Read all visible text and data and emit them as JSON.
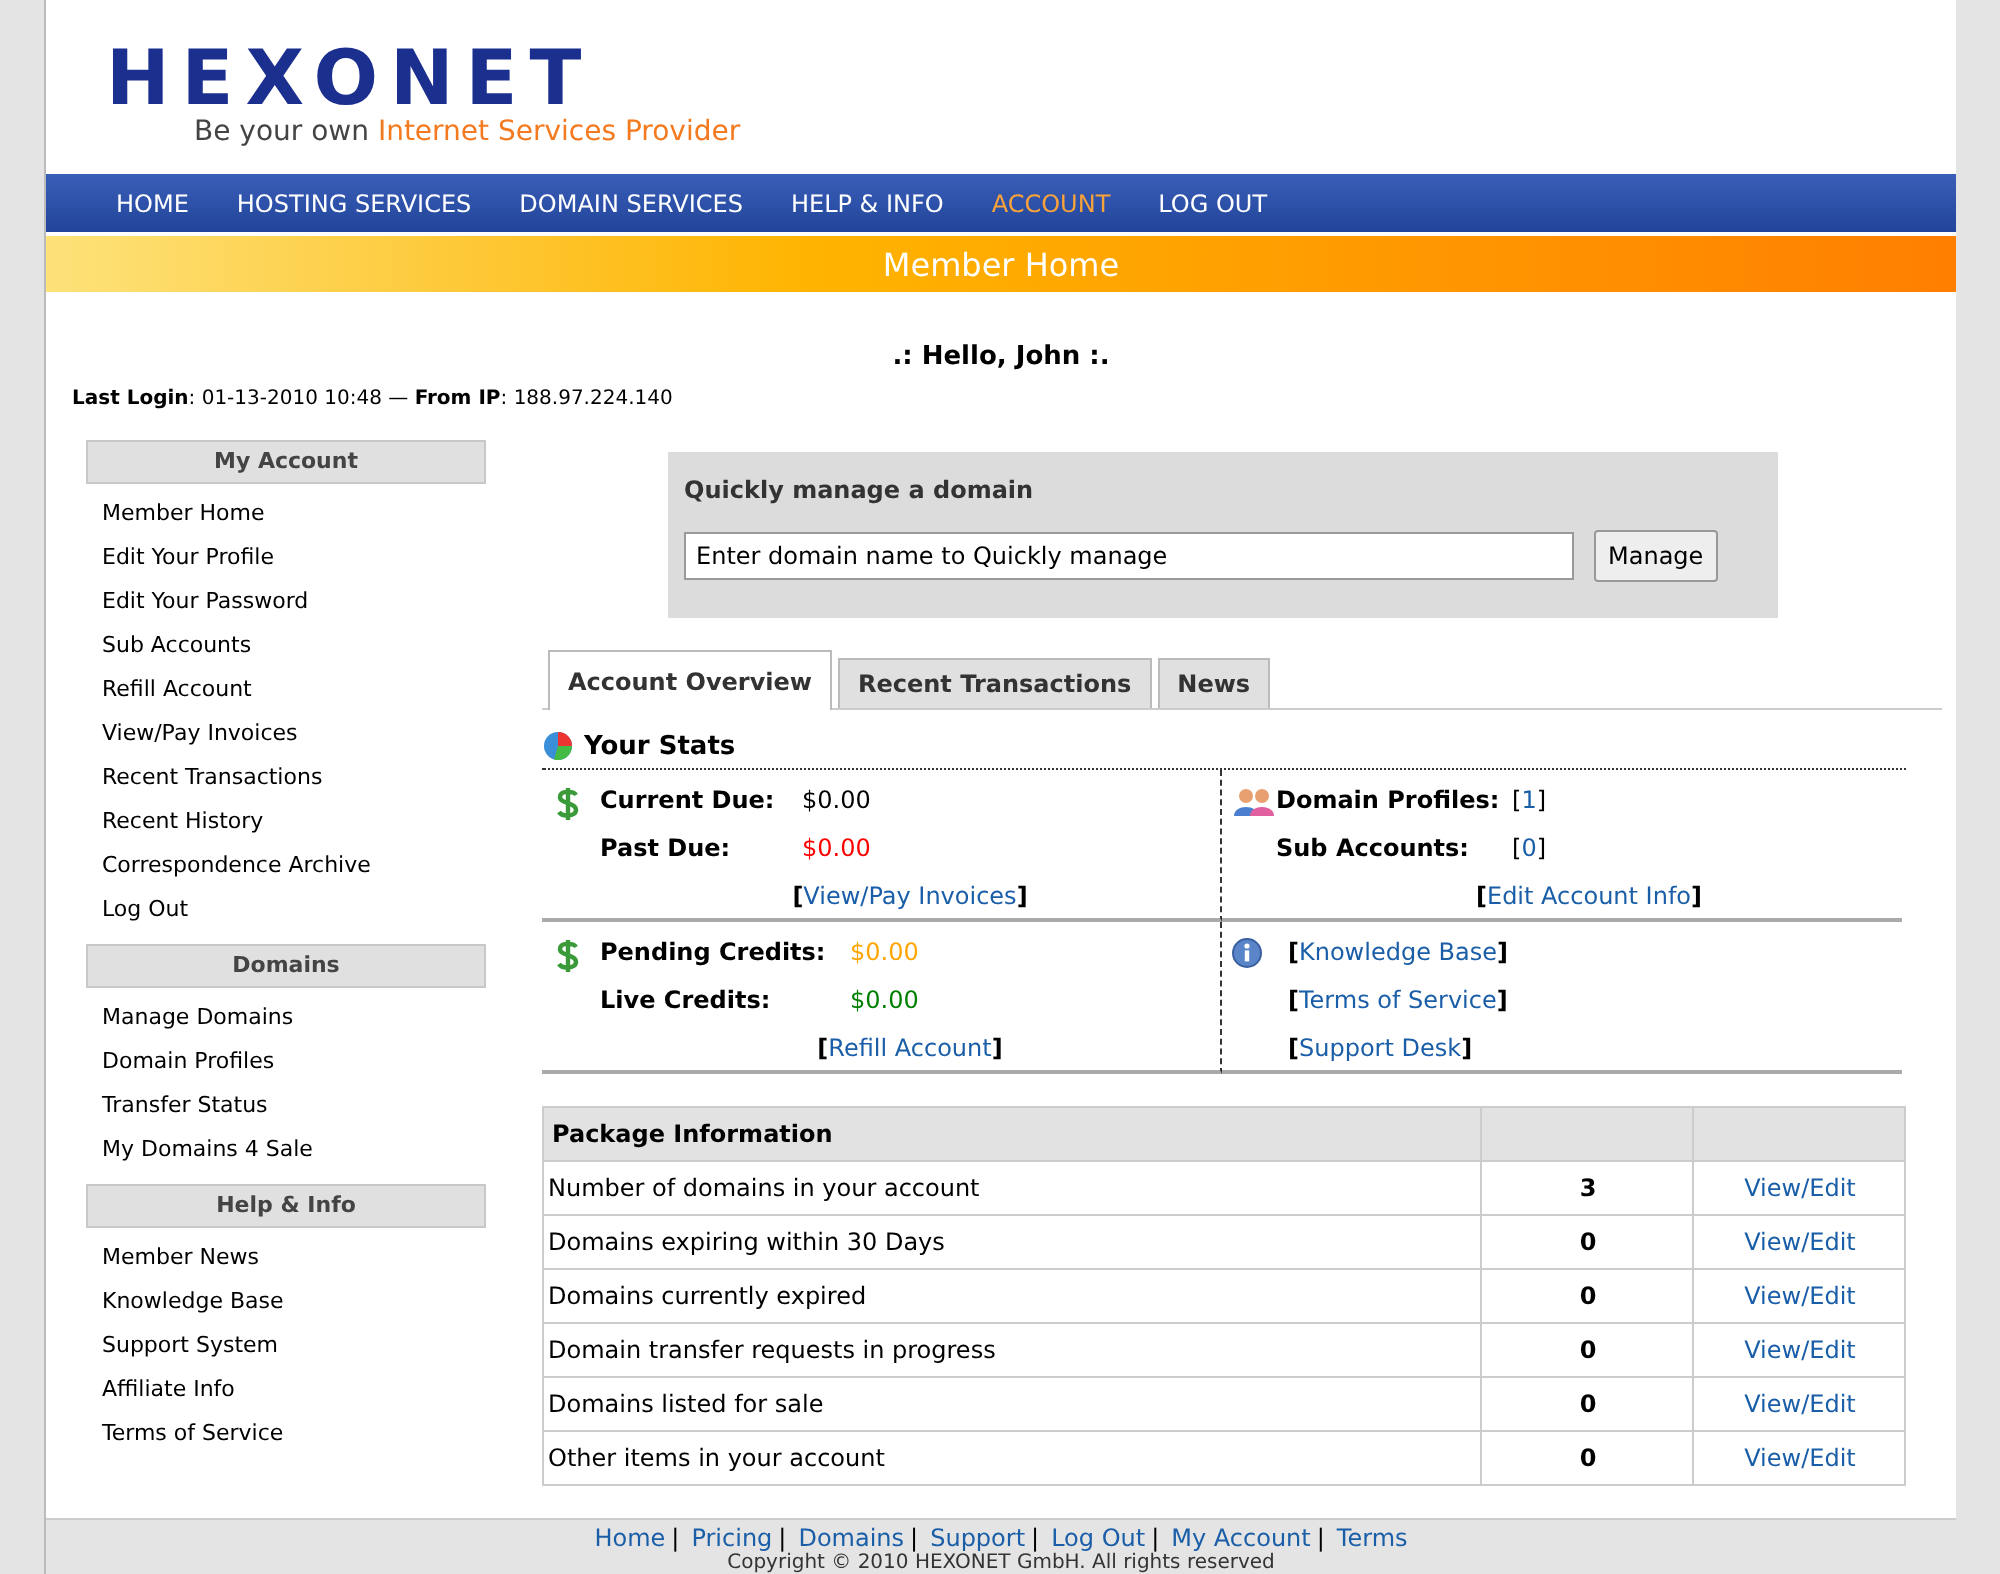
{
  "logo": {
    "name": "HEXONET",
    "tagline_lead": "Be your own",
    "tagline_highlight": "Internet Services Provider"
  },
  "nav": [
    {
      "label": "HOME",
      "selected": false
    },
    {
      "label": "HOSTING SERVICES",
      "selected": false
    },
    {
      "label": "DOMAIN SERVICES",
      "selected": false
    },
    {
      "label": "HELP & INFO",
      "selected": false
    },
    {
      "label": "ACCOUNT",
      "selected": true
    },
    {
      "label": "LOG OUT",
      "selected": false
    }
  ],
  "banner": "Member Home",
  "greeting": ".: Hello, John :.",
  "last_login": "**Last Login**: 01-13-2010 10:48 — **From IP**:  188.97.224.140",
  "sidebar": [
    {
      "title": "My Account",
      "items": [
        "Member Home",
        "Edit Your Profile",
        "Edit Your Password",
        "Sub Accounts",
        "Refill Account",
        "View/Pay Invoices",
        "Recent Transactions",
        "Recent History",
        "Correspondence Archive",
        "Log Out"
      ]
    },
    {
      "title": "Domains",
      "items": [
        "Manage Domains",
        "Domain Profiles",
        "Transfer Status",
        "My Domains 4 Sale"
      ]
    },
    {
      "title": "Help & Info",
      "items": [
        "Member News",
        "Knowledge Base",
        "Support System",
        "Affiliate Info",
        "Terms of Service"
      ]
    }
  ],
  "quick_manage": {
    "title": "Quickly manage a domain",
    "value": "Enter domain name to Quickly manage",
    "button": "Manage"
  },
  "tabs": [
    {
      "label": "Account Overview",
      "selected": true
    },
    {
      "label": "Recent Transactions",
      "selected": false
    },
    {
      "label": "News",
      "selected": false
    }
  ],
  "stats": {
    "title": "Your Stats",
    "blocks": [
      {
        "kind": "dollar",
        "rows": [
          {
            "label": "Current Due:",
            "kind": "amount",
            "value": "$0.00",
            "color": "#000000"
          },
          {
            "label": "Past Due:",
            "kind": "amount",
            "value": "$0.00",
            "color": "#ff0000"
          }
        ],
        "links": [
          {
            "pre": "[",
            "text": "View/Pay Invoices",
            "post": "]"
          }
        ]
      },
      {
        "kind": "people",
        "rows": [
          {
            "label": "Domain Profiles:",
            "kind": "link",
            "pre": "[",
            "value": "1",
            "post": "]"
          },
          {
            "label": "Sub Accounts:",
            "kind": "link",
            "pre": "[",
            "value": "0",
            "post": "]"
          }
        ],
        "links": [
          {
            "pre": "[",
            "text": "Edit Account Info",
            "post": "]"
          }
        ]
      },
      {
        "kind": "dollar",
        "rows": [
          {
            "label": "Pending Credits:",
            "kind": "amount",
            "value": "$0.00",
            "color": "#ffa500"
          },
          {
            "label": "Live Credits:",
            "kind": "amount",
            "value": "$0.00",
            "color": "#008000"
          }
        ],
        "links": [
          {
            "pre": "[",
            "text": "Refill Account",
            "post": "]"
          }
        ]
      },
      {
        "kind": "info",
        "links": [
          {
            "pre": "[",
            "text": "Knowledge Base",
            "post": "]"
          },
          {
            "pre": "[",
            "text": "Terms of Service",
            "post": "]"
          },
          {
            "pre": "[",
            "text": "Support Desk",
            "post": "]"
          }
        ]
      }
    ]
  },
  "package": {
    "title": "Package Information",
    "rows": [
      {
        "label": "Number of domains in your account",
        "count": "3",
        "action": "View/Edit"
      },
      {
        "label": "Domains expiring within 30 Days",
        "count": "0",
        "action": "View/Edit"
      },
      {
        "label": "Domains currently expired",
        "count": "0",
        "action": "View/Edit"
      },
      {
        "label": "Domain transfer requests in progress",
        "count": "0",
        "action": "View/Edit"
      },
      {
        "label": "Domains listed for sale",
        "count": "0",
        "action": "View/Edit"
      },
      {
        "label": "Other items in your account",
        "count": "0",
        "action": "View/Edit"
      }
    ]
  },
  "footer": {
    "links": [
      "Home",
      "Pricing",
      "Domains",
      "Support",
      "Log Out",
      "My Account",
      "Terms"
    ],
    "separator": "|",
    "copyright": "Copyright © 2010 HEXONET GmbH. All rights reserved"
  }
}
